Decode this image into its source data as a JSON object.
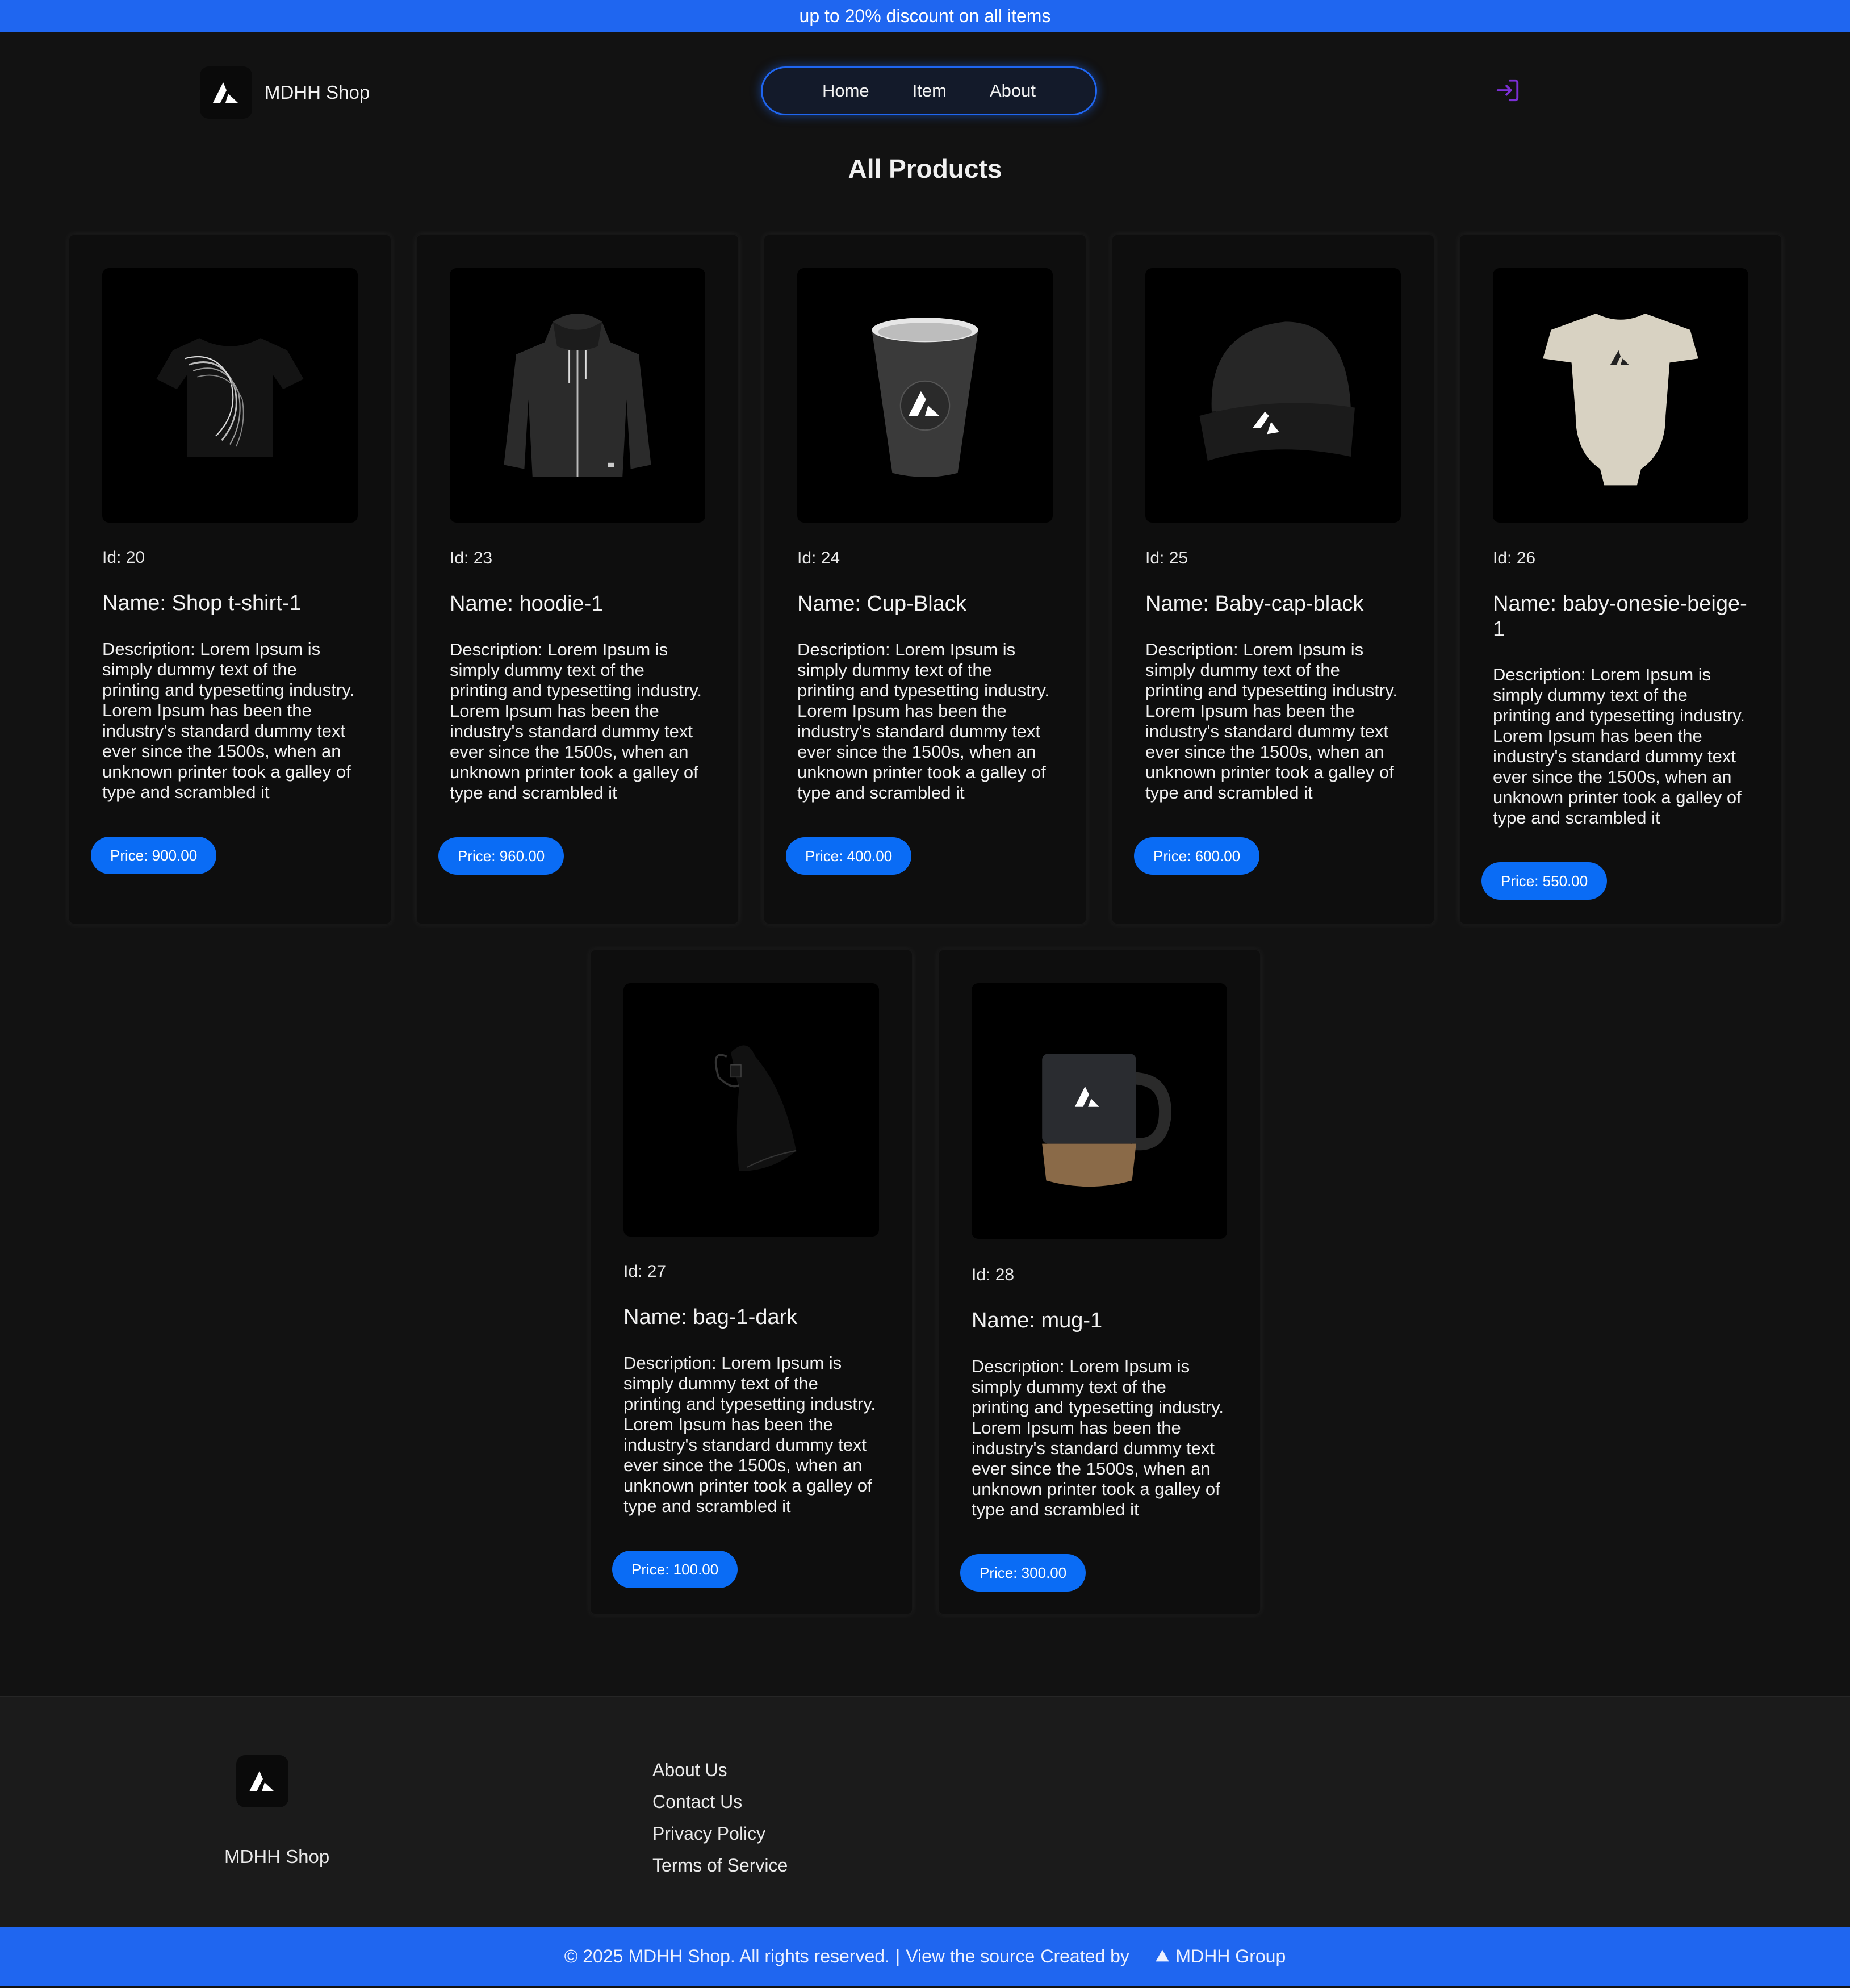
{
  "promo": {
    "text": "up to 20% discount on all items"
  },
  "header": {
    "brand": "MDHH Shop",
    "nav": [
      "Home",
      "Item",
      "About"
    ]
  },
  "page": {
    "title": "All Products"
  },
  "products": [
    {
      "id": "Id: 20",
      "name": "Name: Shop t-shirt-1",
      "description": "Description: Lorem Ipsum is simply dummy text of the printing and typesetting industry. Lorem Ipsum has been the industry's standard dummy text ever since the 1500s, when an unknown printer took a galley of type and scrambled it",
      "price": "Price: 900.00",
      "image": "tshirt-image"
    },
    {
      "id": "Id: 23",
      "name": "Name: hoodie-1",
      "description": "Description: Lorem Ipsum is simply dummy text of the printing and typesetting industry. Lorem Ipsum has been the industry's standard dummy text ever since the 1500s, when an unknown printer took a galley of type and scrambled it",
      "price": "Price: 960.00",
      "image": "hoodie-image"
    },
    {
      "id": "Id: 24",
      "name": "Name: Cup-Black",
      "description": "Description: Lorem Ipsum is simply dummy text of the printing and typesetting industry. Lorem Ipsum has been the industry's standard dummy text ever since the 1500s, when an unknown printer took a galley of type and scrambled it",
      "price": "Price: 400.00",
      "image": "cup-image"
    },
    {
      "id": "Id: 25",
      "name": "Name: Baby-cap-black",
      "description": "Description: Lorem Ipsum is simply dummy text of the printing and typesetting industry. Lorem Ipsum has been the industry's standard dummy text ever since the 1500s, when an unknown printer took a galley of type and scrambled it",
      "price": "Price: 600.00",
      "image": "beanie-image"
    },
    {
      "id": "Id: 26",
      "name": "Name: baby-onesie-beige-1",
      "description": "Description: Lorem Ipsum is simply dummy text of the printing and typesetting industry. Lorem Ipsum has been the industry's standard dummy text ever since the 1500s, when an unknown printer took a galley of type and scrambled it",
      "price": "Price: 550.00",
      "image": "onesie-image"
    },
    {
      "id": "Id: 27",
      "name": "Name: bag-1-dark",
      "description": "Description: Lorem Ipsum is simply dummy text of the printing and typesetting industry. Lorem Ipsum has been the industry's standard dummy text ever since the 1500s, when an unknown printer took a galley of type and scrambled it",
      "price": "Price: 100.00",
      "image": "bag-image"
    },
    {
      "id": "Id: 28",
      "name": "Name: mug-1",
      "description": "Description: Lorem Ipsum is simply dummy text of the printing and typesetting industry. Lorem Ipsum has been the industry's standard dummy text ever since the 1500s, when an unknown printer took a galley of type and scrambled it",
      "price": "Price: 300.00",
      "image": "mug-image"
    }
  ],
  "footer": {
    "brand": "MDHH Shop",
    "links": [
      "About Us",
      "Contact Us",
      "Privacy Policy",
      "Terms of Service"
    ]
  },
  "bottom_bar": {
    "copyright": "© 2025 MDHH Shop. All rights reserved.",
    "separator": "|",
    "source": "View the source",
    "created_by": "Created by",
    "group": "MDHH Group"
  },
  "icons": {
    "logo": "triangle-logo-icon",
    "login": "login-icon"
  },
  "colors": {
    "accent": "#1f66f0",
    "price_button": "#0a6cf5",
    "background": "#121212",
    "login_icon": "#7b2fd6"
  }
}
